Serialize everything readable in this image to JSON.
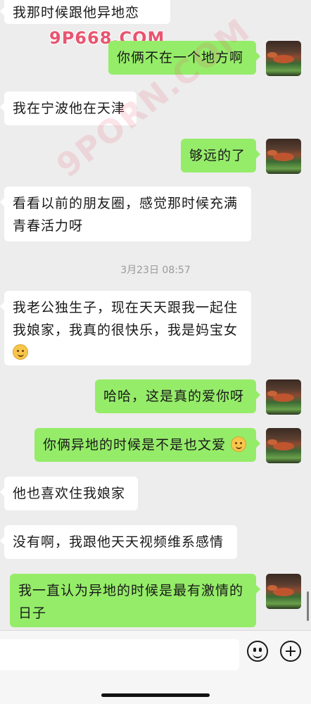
{
  "watermark": {
    "top": "9P668.COM",
    "diagonal": "9PORN.COM"
  },
  "messages": [
    {
      "side": "in",
      "text": "我那时候跟他异地恋"
    },
    {
      "side": "out",
      "text": "你俩不在一个地方啊"
    },
    {
      "side": "in",
      "text": "我在宁波他在天津"
    },
    {
      "side": "out",
      "text": "够远的了"
    },
    {
      "side": "in",
      "text": "看看以前的朋友圈，感觉那时候充满青春活力呀"
    },
    {
      "side": "in",
      "text": "我老公独生子，现在天天跟我一起住我娘家，我真的很快乐，我是妈宝女",
      "emoji": "thinking-face-emoji"
    },
    {
      "side": "out",
      "text": "哈哈，这是真的爱你呀"
    },
    {
      "side": "out",
      "text": "你俩异地的时候是不是也文爱",
      "emoji": "thinking-face-emoji"
    },
    {
      "side": "in",
      "text": "他也喜欢住我娘家"
    },
    {
      "side": "in",
      "text": "没有啊，我跟他天天视频维系感情"
    },
    {
      "side": "out",
      "text": "我一直认为异地的时候是最有激情的日子"
    }
  ],
  "timestamp": "3月23日 08:57",
  "input_bar": {
    "placeholder": "",
    "icons": [
      "emoji-button-icon",
      "plus-button-icon"
    ]
  },
  "colors": {
    "background": "#ededed",
    "incoming_bubble": "#ffffff",
    "outgoing_bubble": "#95ec69",
    "text": "#191919",
    "timestamp": "#9a9a9a"
  }
}
